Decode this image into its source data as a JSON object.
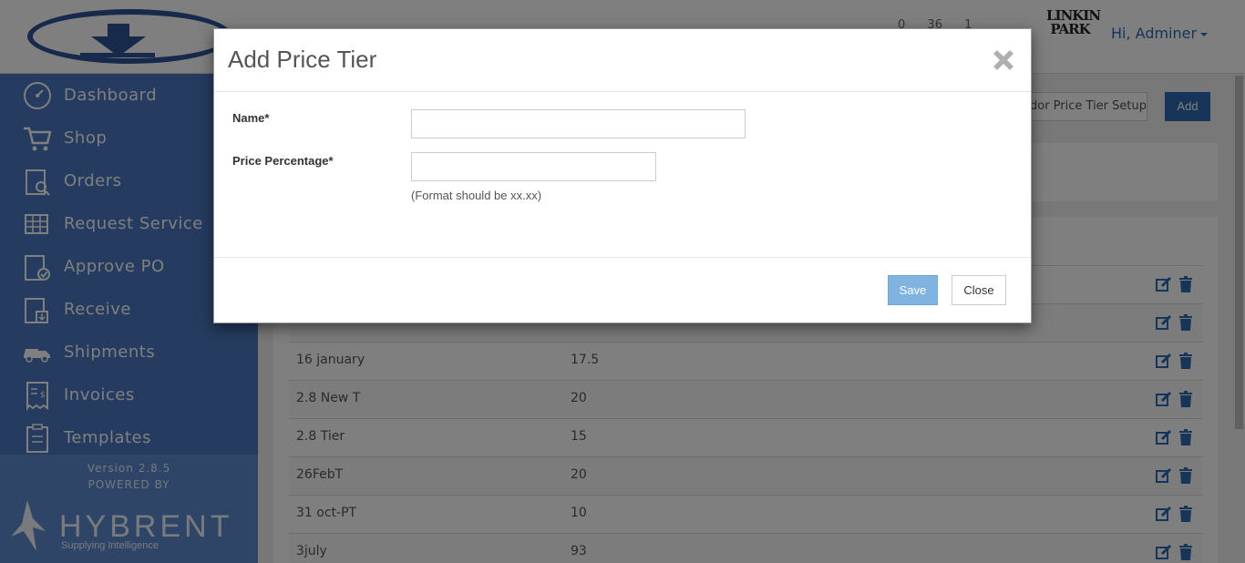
{
  "header": {
    "counts": [
      "0",
      "36",
      "1"
    ],
    "brand_mark": "LINKIN PARK",
    "user_greeting": "Hi, Adminer"
  },
  "sidebar": {
    "items": [
      {
        "label": "Dashboard",
        "icon": "dashboard-icon"
      },
      {
        "label": "Shop",
        "icon": "cart-icon"
      },
      {
        "label": "Orders",
        "icon": "orders-icon"
      },
      {
        "label": "Request Service",
        "icon": "request-service-icon"
      },
      {
        "label": "Approve PO",
        "icon": "approve-po-icon"
      },
      {
        "label": "Receive",
        "icon": "receive-icon"
      },
      {
        "label": "Shipments",
        "icon": "truck-icon"
      },
      {
        "label": "Invoices",
        "icon": "invoice-icon"
      },
      {
        "label": "Templates",
        "icon": "templates-icon"
      }
    ],
    "version": "Version 2.8.5",
    "powered_by": "POWERED BY",
    "company": "HYBRENT",
    "tagline": "Supplying Intelligence"
  },
  "toolbar": {
    "setup_button": "Vendor Price Tier Setup",
    "add_button": "Add"
  },
  "table": {
    "rows": [
      {
        "name": "",
        "percentage": ""
      },
      {
        "name": "",
        "percentage": ""
      },
      {
        "name": "16 january",
        "percentage": "17.5"
      },
      {
        "name": "2.8 New T",
        "percentage": "20"
      },
      {
        "name": "2.8 Tier",
        "percentage": "15"
      },
      {
        "name": "26FebT",
        "percentage": "20"
      },
      {
        "name": "31 oct-PT",
        "percentage": "10"
      },
      {
        "name": "3july",
        "percentage": "93"
      }
    ]
  },
  "modal": {
    "title": "Add Price Tier",
    "name_label": "Name*",
    "name_value": "",
    "percentage_label": "Price Percentage*",
    "percentage_value": "",
    "percentage_hint": "(Format should be xx.xx)",
    "save_button": "Save",
    "close_button": "Close"
  },
  "colors": {
    "sidebar": "#4a78c0",
    "primary": "#2f6bb3",
    "save_button": "#80b3e0"
  }
}
